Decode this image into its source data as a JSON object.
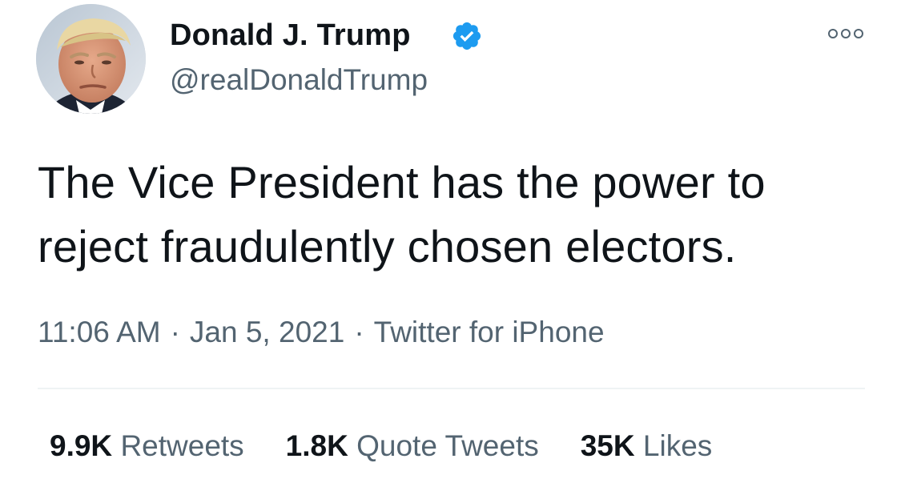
{
  "author": {
    "name": "Donald J. Trump",
    "handle": "@realDonaldTrump",
    "verified": true,
    "avatar_icon": "profile-photo",
    "verified_icon": "verified-badge-icon",
    "verified_color": "#1d9bf0"
  },
  "menu": {
    "icon": "more-options-icon"
  },
  "tweet": {
    "text": "The Vice President has the power to reject fraudulently chosen electors.",
    "time": "11:06 AM",
    "separator": "·",
    "date": "Jan 5, 2021",
    "source": "Twitter for iPhone"
  },
  "stats": {
    "retweets": {
      "count": "9.9K",
      "label": "Retweets"
    },
    "quote_tweets": {
      "count": "1.8K",
      "label": "Quote Tweets"
    },
    "likes": {
      "count": "35K",
      "label": "Likes"
    }
  },
  "colors": {
    "text_primary": "#0f1419",
    "text_secondary": "#536471",
    "divider": "#eff3f4"
  }
}
